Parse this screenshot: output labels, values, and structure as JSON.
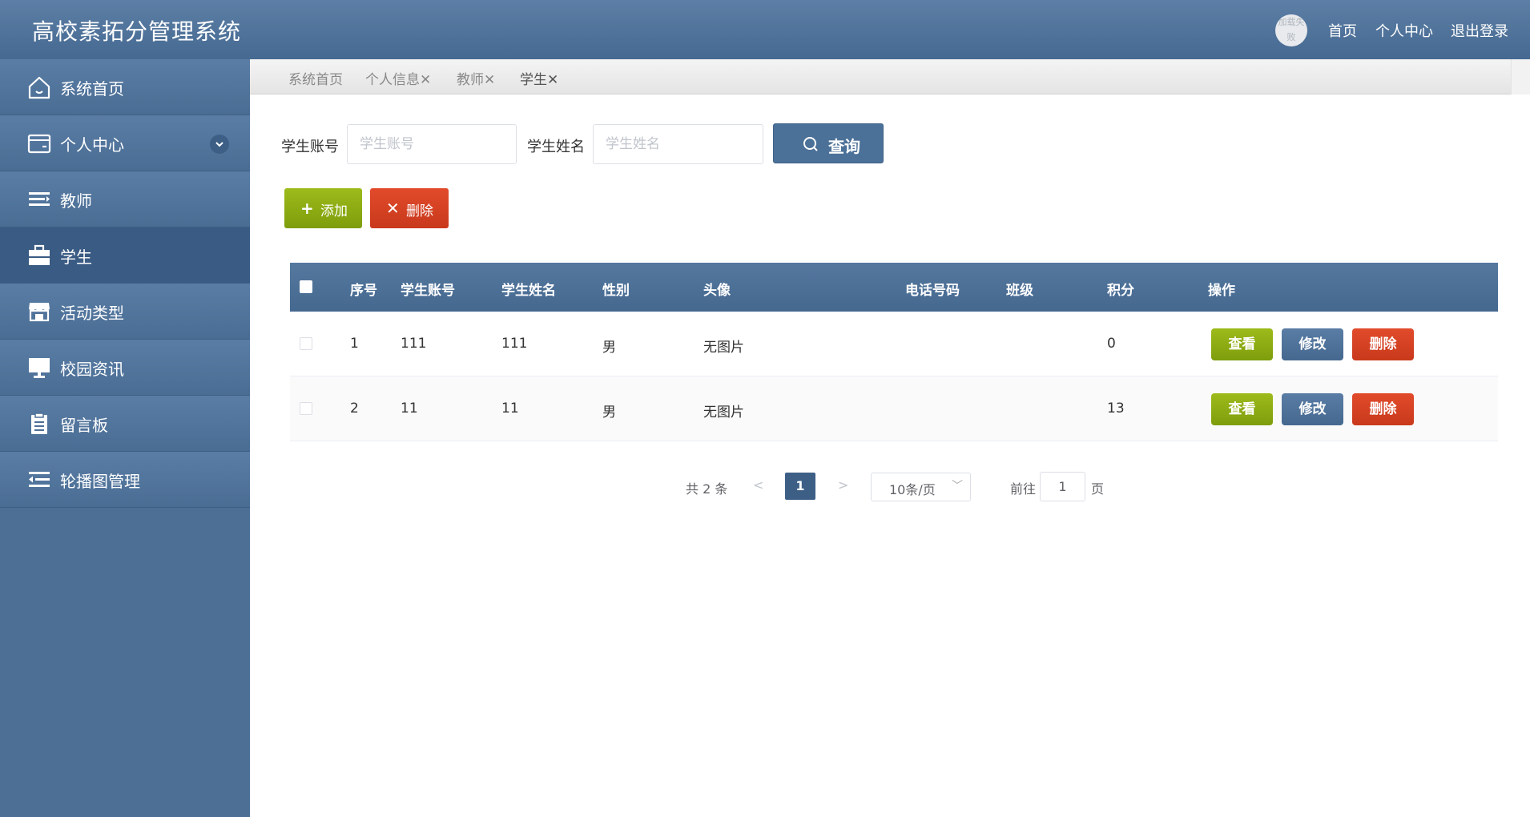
{
  "header": {
    "title": "高校素拓分管理系统",
    "avatar_text": "加载失败",
    "links": [
      "首页",
      "个人中心",
      "退出登录"
    ]
  },
  "sidebar": {
    "items": [
      {
        "label": "系统首页",
        "icon": "home-icon"
      },
      {
        "label": "个人中心",
        "icon": "wallet-icon"
      },
      {
        "label": "教师",
        "icon": "list-icon"
      },
      {
        "label": "学生",
        "icon": "briefcase-icon",
        "active": true
      },
      {
        "label": "活动类型",
        "icon": "shop-icon"
      },
      {
        "label": "校园资讯",
        "icon": "monitor-icon"
      },
      {
        "label": "留言板",
        "icon": "clipboard-icon"
      },
      {
        "label": "轮播图管理",
        "icon": "indent-icon"
      }
    ]
  },
  "tabs": [
    {
      "label": "系统首页"
    },
    {
      "label": "个人信息",
      "closable": true
    },
    {
      "label": "教师",
      "closable": true
    },
    {
      "label": "学生",
      "closable": true,
      "active": true
    }
  ],
  "search": {
    "account_label": "学生账号",
    "account_placeholder": "学生账号",
    "account_value": "",
    "name_label": "学生姓名",
    "name_placeholder": "学生姓名",
    "name_value": "",
    "query_button": "查询"
  },
  "actions": {
    "add_button": "添加",
    "delete_button": "删除"
  },
  "table": {
    "columns": [
      "序号",
      "学生账号",
      "学生姓名",
      "性别",
      "头像",
      "电话号码",
      "班级",
      "积分",
      "操作"
    ],
    "rows": [
      {
        "index": "1",
        "account": "111",
        "name": "111",
        "gender": "男",
        "avatar": "无图片",
        "phone": "",
        "class": "",
        "score": "0"
      },
      {
        "index": "2",
        "account": "11",
        "name": "11",
        "gender": "男",
        "avatar": "无图片",
        "phone": "",
        "class": "",
        "score": "13"
      }
    ],
    "row_buttons": {
      "view": "查看",
      "edit": "修改",
      "delete": "删除"
    }
  },
  "pagination": {
    "total_text": "共 2 条",
    "current_page": "1",
    "page_size": "10条/页",
    "goto_label": "前往",
    "goto_value": "1",
    "page_unit": "页",
    "prev": "<",
    "next": ">"
  },
  "colors": {
    "header": "#4d7099",
    "sidebar": "#4d6f96",
    "primary": "#4c7198",
    "success": "#8aab13",
    "danger": "#d6401f"
  }
}
